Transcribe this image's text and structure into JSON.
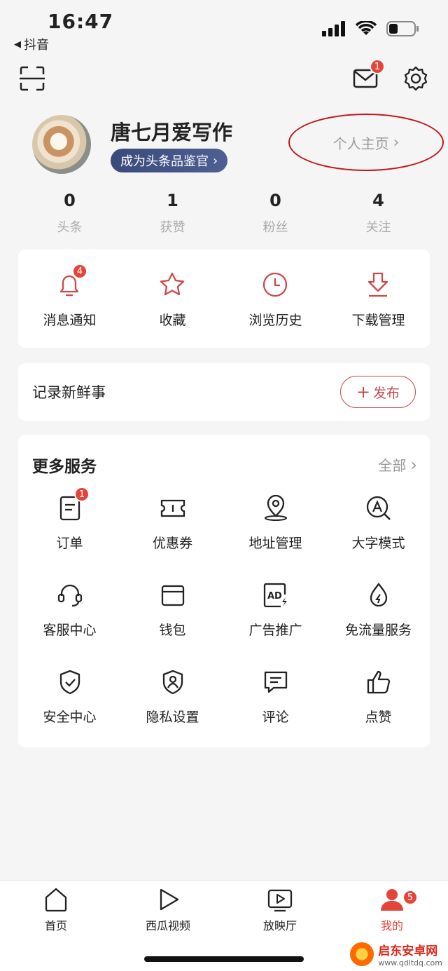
{
  "status_bar": {
    "time": "16:47",
    "back_app": "抖音"
  },
  "header": {
    "mail_badge": "1"
  },
  "profile": {
    "name": "唐七月爱写作",
    "pill_label": "成为头条品鉴官",
    "homepage_link": "个人主页"
  },
  "stats": [
    {
      "value": "0",
      "label": "头条"
    },
    {
      "value": "1",
      "label": "获赞"
    },
    {
      "value": "0",
      "label": "粉丝"
    },
    {
      "value": "4",
      "label": "关注"
    }
  ],
  "quick_actions": [
    {
      "label": "消息通知",
      "icon": "bell-icon",
      "badge": "4"
    },
    {
      "label": "收藏",
      "icon": "star-icon"
    },
    {
      "label": "浏览历史",
      "icon": "clock-icon"
    },
    {
      "label": "下载管理",
      "icon": "download-icon"
    }
  ],
  "record": {
    "title": "记录新鲜事",
    "publish_label": "发布"
  },
  "services": {
    "title": "更多服务",
    "all_label": "全部",
    "items": [
      {
        "label": "订单",
        "icon": "order-icon",
        "badge": "1"
      },
      {
        "label": "优惠券",
        "icon": "coupon-icon"
      },
      {
        "label": "地址管理",
        "icon": "location-icon"
      },
      {
        "label": "大字模式",
        "icon": "large-font-icon"
      },
      {
        "label": "客服中心",
        "icon": "headset-icon"
      },
      {
        "label": "钱包",
        "icon": "wallet-icon"
      },
      {
        "label": "广告推广",
        "icon": "ad-icon"
      },
      {
        "label": "免流量服务",
        "icon": "drop-icon"
      },
      {
        "label": "安全中心",
        "icon": "shield-icon"
      },
      {
        "label": "隐私设置",
        "icon": "privacy-icon"
      },
      {
        "label": "评论",
        "icon": "comment-icon"
      },
      {
        "label": "点赞",
        "icon": "thumbs-up-icon"
      }
    ]
  },
  "tabbar": [
    {
      "label": "首页",
      "icon": "home-icon"
    },
    {
      "label": "西瓜视频",
      "icon": "play-icon"
    },
    {
      "label": "放映厅",
      "icon": "tv-icon"
    },
    {
      "label": "我的",
      "icon": "user-icon",
      "badge": "5",
      "active": true
    }
  ],
  "watermark": {
    "name": "启东安卓网",
    "url": "www.qdltdq.com"
  },
  "colors": {
    "accent": "#e4453b",
    "icon_red": "#c94b4b",
    "pill": "#3a4a7a",
    "background": "#f5f5f5"
  }
}
